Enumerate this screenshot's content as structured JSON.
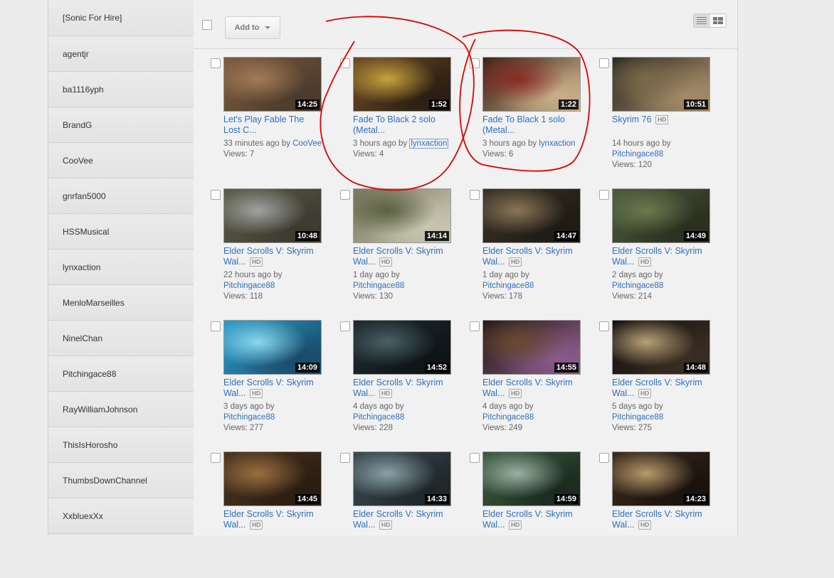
{
  "sidebar": {
    "items": [
      {
        "label": "[Sonic For Hire]"
      },
      {
        "label": "agentjr"
      },
      {
        "label": "ba1116yph"
      },
      {
        "label": "BrandG"
      },
      {
        "label": "CooVee"
      },
      {
        "label": "gnrfan5000"
      },
      {
        "label": "HSSMusical"
      },
      {
        "label": "lynxaction"
      },
      {
        "label": "MenloMarseilles"
      },
      {
        "label": "NinelChan"
      },
      {
        "label": "Pitchingace88"
      },
      {
        "label": "RayWilliamJohnson"
      },
      {
        "label": "ThisIsHorosho"
      },
      {
        "label": "ThumbsDownChannel"
      },
      {
        "label": "XxbluexXx"
      }
    ]
  },
  "toolbar": {
    "add_to_label": "Add to",
    "view_icons": [
      "list-view-icon",
      "grid-view-icon"
    ]
  },
  "videos": [
    {
      "duration": "14:25",
      "title_line1": "Let's Play Fable The",
      "title_line2": "Lost C...",
      "hd": "",
      "age": "33 minutes ago",
      "by": "by",
      "author": "CooVee",
      "views": "Views: 7",
      "colors": [
        "#7a5a3f",
        "#a37b57",
        "#4b3a2b"
      ]
    },
    {
      "duration": "1:52",
      "title_line1": "Fade To Black 2 solo",
      "title_line2": "(Metal...",
      "hd": "",
      "age": "3 hours ago",
      "by": "by",
      "author": "lynxaction",
      "views": "Views: 4",
      "colors": [
        "#6a4a26",
        "#c7a23c",
        "#2a1d12"
      ]
    },
    {
      "duration": "1:22",
      "title_line1": "Fade To Black 1 solo",
      "title_line2": "(Metal...",
      "hd": "",
      "age": "3 hours ago",
      "by": "by",
      "author": "lynxaction",
      "views": "Views: 6",
      "colors": [
        "#3a2418",
        "#8a2a24",
        "#c9b08a"
      ]
    },
    {
      "duration": "10:51",
      "title_line1": "Skyrim 76",
      "title_line2": "",
      "hd": "HD",
      "age": "14 hours ago",
      "by": "by",
      "author": "Pitchingace88",
      "views": "Views: 120",
      "colors": [
        "#2c2a22",
        "#7a6a4a",
        "#a48a68"
      ]
    },
    {
      "duration": "10:48",
      "title_line1": "Elder Scrolls V: Skyrim",
      "title_line2": "Wal...",
      "hd": "HD",
      "age": "22 hours ago",
      "by": "by",
      "author": "Pitchingace88",
      "views": "Views: 118",
      "colors": [
        "#5a5a48",
        "#9ea2a0",
        "#3c3a2e"
      ]
    },
    {
      "duration": "14:14",
      "title_line1": "Elder Scrolls V: Skyrim",
      "title_line2": "Wal...",
      "hd": "HD",
      "age": "1 day ago",
      "by": "by",
      "author": "Pitchingace88",
      "views": "Views: 130",
      "colors": [
        "#7a7860",
        "#5a6040",
        "#c8c6b0"
      ]
    },
    {
      "duration": "14:47",
      "title_line1": "Elder Scrolls V: Skyrim",
      "title_line2": "Wal...",
      "hd": "HD",
      "age": "1 day ago",
      "by": "by",
      "author": "Pitchingace88",
      "views": "Views: 178",
      "colors": [
        "#3a3226",
        "#8a7658",
        "#1e1a14"
      ]
    },
    {
      "duration": "14:49",
      "title_line1": "Elder Scrolls V: Skyrim",
      "title_line2": "Wal...",
      "hd": "HD",
      "age": "2 days ago",
      "by": "by",
      "author": "Pitchingace88",
      "views": "Views: 214",
      "colors": [
        "#4a5a3a",
        "#6a7a4e",
        "#2a2e1e"
      ]
    },
    {
      "duration": "14:09",
      "title_line1": "Elder Scrolls V: Skyrim",
      "title_line2": "Wal...",
      "hd": "HD",
      "age": "3 days ago",
      "by": "by",
      "author": "Pitchingace88",
      "views": "Views: 277",
      "colors": [
        "#2a9ac8",
        "#8ad8f0",
        "#1a4a6a"
      ]
    },
    {
      "duration": "14:52",
      "title_line1": "Elder Scrolls V: Skyrim",
      "title_line2": "Wal...",
      "hd": "HD",
      "age": "4 days ago",
      "by": "by",
      "author": "Pitchingace88",
      "views": "Views: 228",
      "colors": [
        "#1e2a2e",
        "#4a6066",
        "#0e1416"
      ]
    },
    {
      "duration": "14:55",
      "title_line1": "Elder Scrolls V: Skyrim",
      "title_line2": "Wal...",
      "hd": "HD",
      "age": "4 days ago",
      "by": "by",
      "author": "Pitchingace88",
      "views": "Views: 249",
      "colors": [
        "#241a14",
        "#6a4a30",
        "#8a5a8a"
      ]
    },
    {
      "duration": "14:48",
      "title_line1": "Elder Scrolls V: Skyrim",
      "title_line2": "Wal...",
      "hd": "HD",
      "age": "5 days ago",
      "by": "by",
      "author": "Pitchingace88",
      "views": "Views: 275",
      "colors": [
        "#14110e",
        "#b8a078",
        "#3a2e22"
      ]
    },
    {
      "duration": "14:45",
      "title_line1": "Elder Scrolls V: Skyrim",
      "title_line2": "Wal...",
      "hd": "HD",
      "age": "",
      "by": "",
      "author": "",
      "views": "",
      "colors": [
        "#4a3420",
        "#9a7040",
        "#2a1c10"
      ]
    },
    {
      "duration": "14:33",
      "title_line1": "Elder Scrolls V: Skyrim",
      "title_line2": "Wal...",
      "hd": "HD",
      "age": "",
      "by": "",
      "author": "",
      "views": "",
      "colors": [
        "#3a4a50",
        "#8aa0a8",
        "#1e2628"
      ]
    },
    {
      "duration": "14:59",
      "title_line1": "Elder Scrolls V: Skyrim",
      "title_line2": "Wal...",
      "hd": "HD",
      "age": "",
      "by": "",
      "author": "",
      "views": "",
      "colors": [
        "#3a5a40",
        "#9ab0a0",
        "#1a2a1e"
      ]
    },
    {
      "duration": "14:23",
      "title_line1": "Elder Scrolls V: Skyrim",
      "title_line2": "Wal...",
      "hd": "HD",
      "age": "",
      "by": "",
      "author": "",
      "views": "",
      "colors": [
        "#3a2a1e",
        "#b89a6a",
        "#1a120c"
      ]
    }
  ],
  "colors": {
    "link": "#2f6fbf",
    "annotation": "#e00000"
  }
}
